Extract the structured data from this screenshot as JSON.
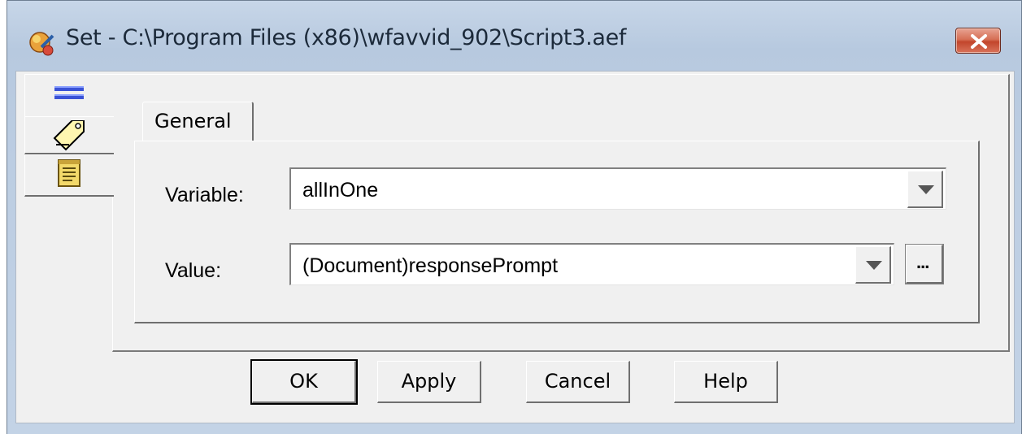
{
  "window": {
    "title": "Set - C:\\Program Files (x86)\\wfavvid_902\\Script3.aef"
  },
  "side_tabs": [
    {
      "name": "general-lines-icon"
    },
    {
      "name": "tag-icon"
    },
    {
      "name": "notes-icon"
    }
  ],
  "tabs": {
    "active": "General"
  },
  "form": {
    "variable_label": "Variable:",
    "variable_value": "allInOne",
    "value_label": "Value:",
    "value_value": "(Document)responsePrompt",
    "ellipsis": "..."
  },
  "buttons": {
    "ok": "OK",
    "apply": "Apply",
    "cancel": "Cancel",
    "help": "Help"
  },
  "colors": {
    "titlebar": "#b7c9df",
    "client": "#f0f0f0",
    "close_button": "#c2462c"
  }
}
